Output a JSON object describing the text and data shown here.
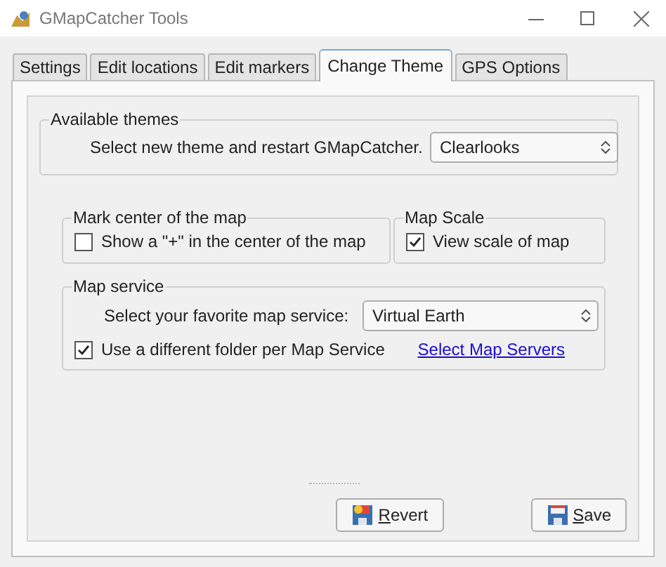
{
  "window": {
    "title": "GMapCatcher Tools"
  },
  "tabs": [
    {
      "label": "Settings",
      "selected": false
    },
    {
      "label": "Edit locations",
      "selected": false
    },
    {
      "label": "Edit markers",
      "selected": false
    },
    {
      "label": "Change Theme",
      "selected": true
    },
    {
      "label": "GPS Options",
      "selected": false
    }
  ],
  "available_themes": {
    "title": "Available themes",
    "prompt": "Select new theme and restart GMapCatcher.",
    "theme": "Clearlooks"
  },
  "mark_center": {
    "title": "Mark center of the map",
    "label": "Show a \"+\" in the center of the map",
    "checked": false
  },
  "map_scale": {
    "title": "Map Scale",
    "label": "View scale of map",
    "checked": true
  },
  "map_service": {
    "title": "Map service",
    "prompt": "Select your favorite map service:",
    "service": "Virtual Earth",
    "folder_label": "Use a different folder per Map Service",
    "folder_checked": true,
    "link": "Select Map Servers"
  },
  "buttons": [
    {
      "label": "Revert",
      "kind": "revert"
    },
    {
      "label": "Save",
      "kind": "save"
    }
  ]
}
